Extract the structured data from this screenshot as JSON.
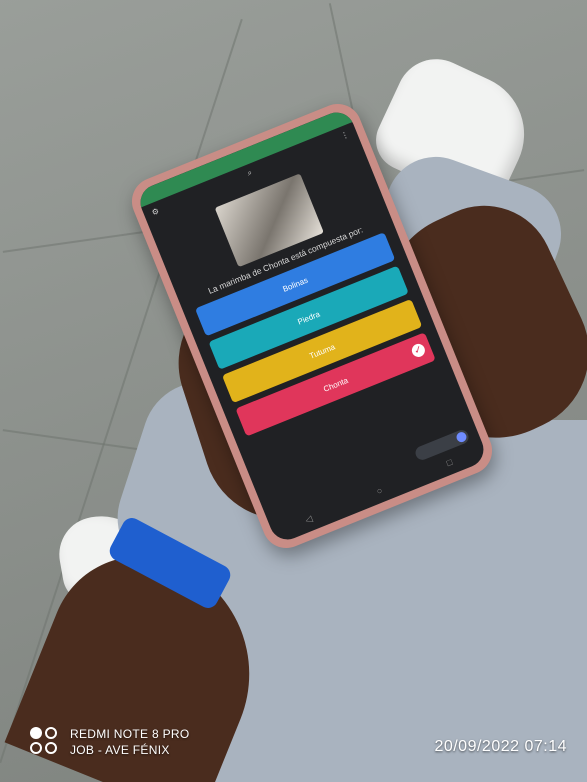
{
  "phone_quiz": {
    "question": "La marimba de Chonta está compuesta por:",
    "options": [
      {
        "label": "Bolinas",
        "color": "#2f7de1"
      },
      {
        "label": "Piedra",
        "color": "#1aa9b8"
      },
      {
        "label": "Tutuma",
        "color": "#e1b31b"
      },
      {
        "label": "Chonta",
        "color": "#e0365b",
        "selected": true
      }
    ]
  },
  "watermark": {
    "device_line": "REDMI NOTE 8 PRO",
    "author_line": "JOB - AVE FÉNIX"
  },
  "timestamp": "20/09/2022 07:14",
  "colors": {
    "floor": "#8e938e",
    "pants": "#a9b3bf",
    "wristband": "#1f5fcf",
    "phone_case": "#c98d86",
    "status_bar": "#2f8a52"
  }
}
